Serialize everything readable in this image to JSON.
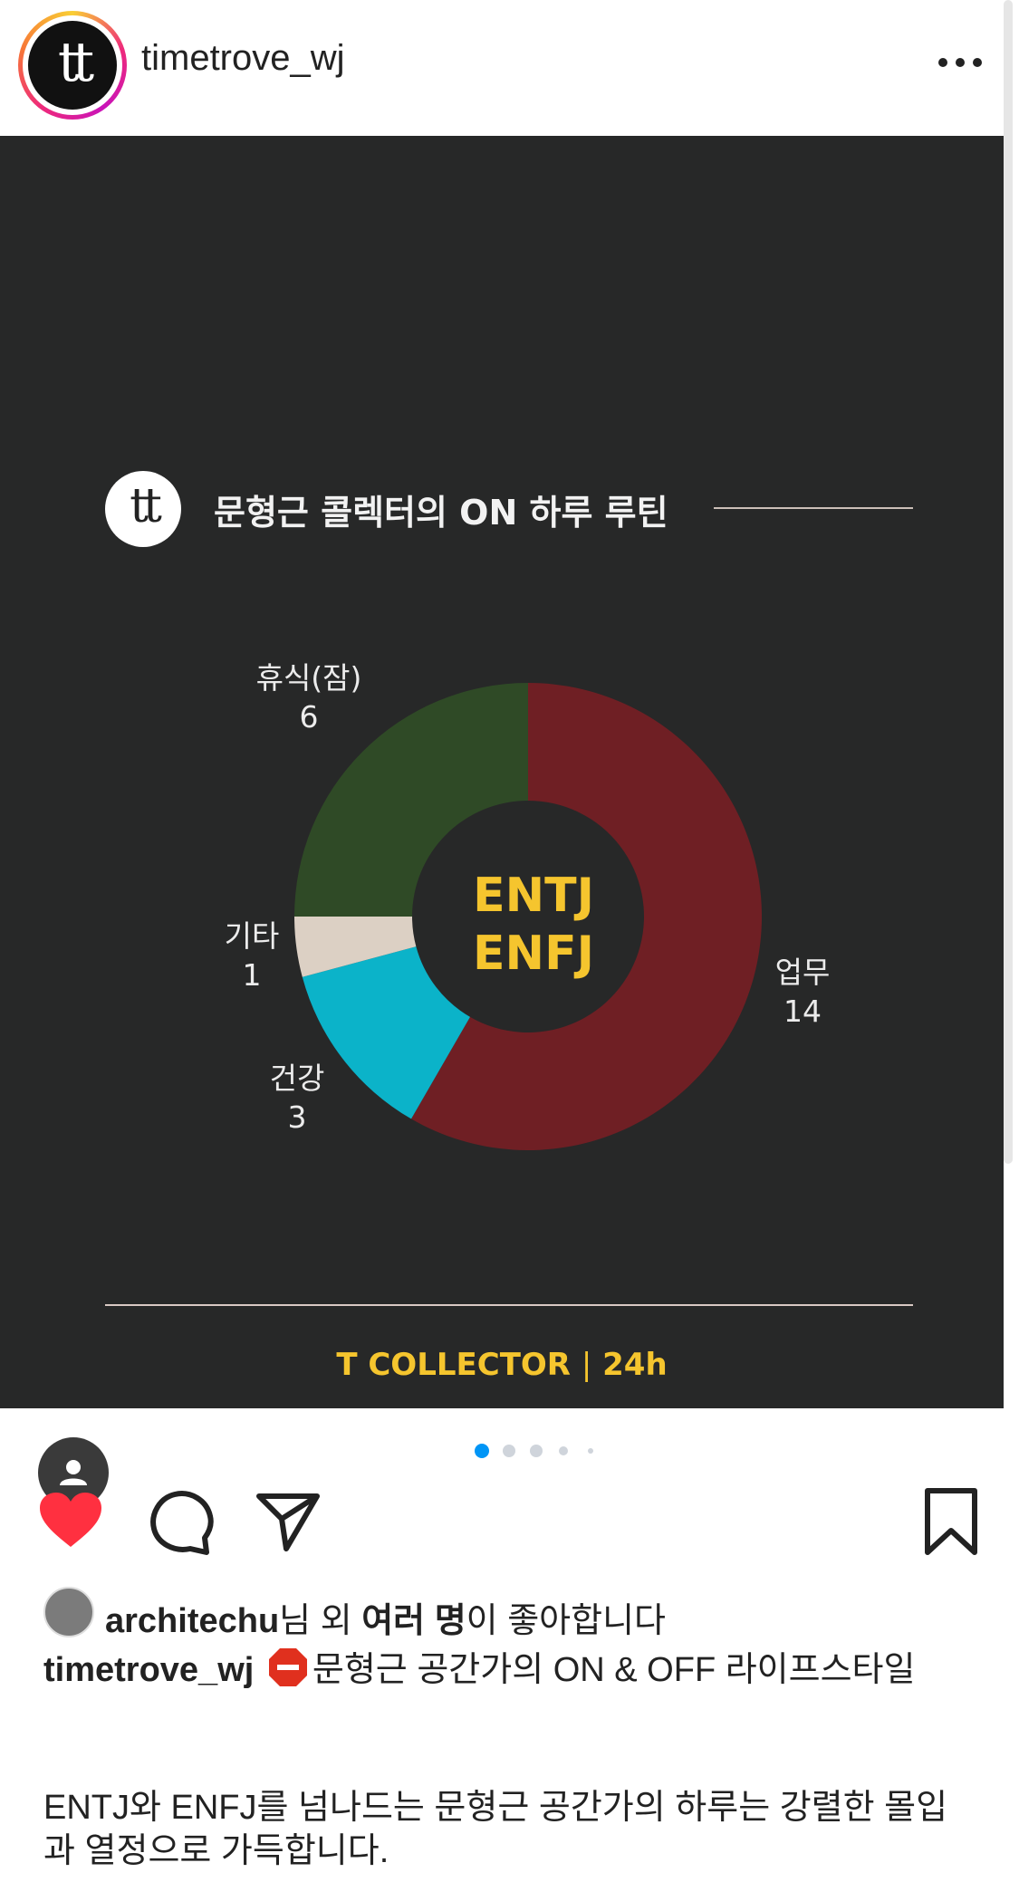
{
  "header": {
    "username": "timetrove_wj",
    "avatar_logo": "tt",
    "more_icon": "more-horizontal-icon"
  },
  "post": {
    "card_logo": "tt",
    "card_title": "문형근 콜렉터의 ON 하루 루틴",
    "footer_brand": "T COLLECTOR",
    "footer_separator": "|",
    "footer_duration": "24h",
    "user_tag_icon": "person-icon"
  },
  "chart_data": {
    "type": "pie",
    "style": "donut",
    "center_text": [
      "ENTJ",
      "ENFJ"
    ],
    "slices": [
      {
        "label": "업무",
        "value": 14,
        "color": "#6f1f24"
      },
      {
        "label": "건강",
        "value": 3,
        "color": "#0bb3c9"
      },
      {
        "label": "기타",
        "value": 1,
        "color": "#dcd0c4"
      },
      {
        "label": "휴식(잠)",
        "value": 6,
        "color": "#2f4a26"
      }
    ],
    "legend": "none"
  },
  "carousel": {
    "dot_count": 5,
    "active_index": 0,
    "active_color": "#0095f6"
  },
  "actions": {
    "like_icon": "heart-filled-icon",
    "comment_icon": "comment-icon",
    "share_icon": "send-icon",
    "save_icon": "bookmark-icon",
    "like_color": "#ff3040"
  },
  "likes": {
    "liker": "architechu",
    "suffix_1": "님 외 ",
    "others": "여러 명",
    "suffix_2": "이 좋아합니다"
  },
  "caption": {
    "username": "timetrove_wj",
    "emoji_icon": "stop-sign-icon",
    "text": "문형근 공간가의 ON & OFF 라이프스타일",
    "body": "ENTJ와 ENFJ를 넘나드는 문형근 공간가의 하루는 강렬한 몰입과 열정으로 가득합니다."
  }
}
